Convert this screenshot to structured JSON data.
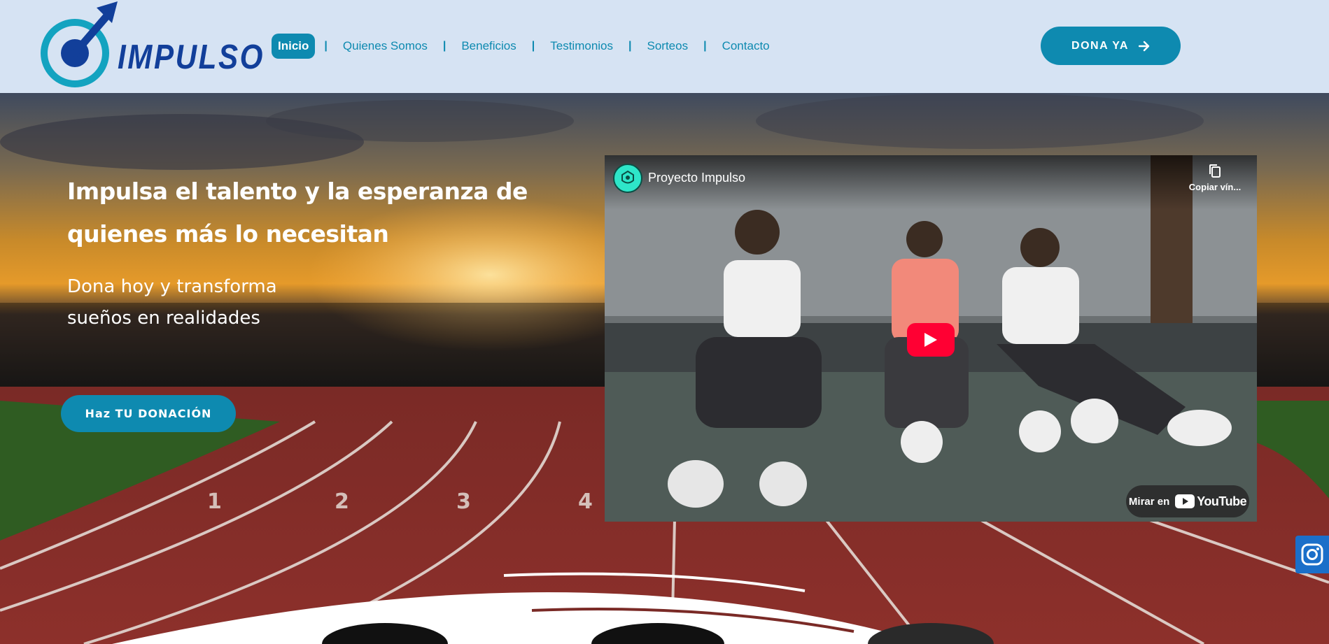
{
  "header": {
    "logo_text": "IMPULSO",
    "nav": [
      {
        "label": "Inicio",
        "active": true
      },
      {
        "label": "Quienes Somos"
      },
      {
        "label": "Beneficios"
      },
      {
        "label": "Testimonios"
      },
      {
        "label": "Sorteos"
      },
      {
        "label": "Contacto"
      }
    ],
    "nav_separator": "|",
    "cta_label": "DONA YA",
    "cta_icon": "arrow-right-icon"
  },
  "hero": {
    "title_line1": "Impulsa el talento y la esperanza de",
    "title_line2": "quienes más lo necesitan",
    "subtitle_line1": "Dona hoy y transforma",
    "subtitle_line2": "sueños en realidades",
    "button_label": "Haz TU DONACIÓN"
  },
  "video": {
    "channel_title": "Proyecto Impulso",
    "copy_link_label": "Copiar vín...",
    "watch_on_label": "Mirar en",
    "platform_label": "YouTube",
    "play_icon": "play-icon",
    "copy_icon": "copy-icon"
  },
  "social": {
    "instagram_icon": "instagram-icon"
  },
  "colors": {
    "header_bg": "#d6e3f3",
    "accent": "#0e8ab0",
    "logo_blue": "#123f9a",
    "youtube_red": "#ff0033",
    "instagram_blue": "#1b6fc9"
  }
}
